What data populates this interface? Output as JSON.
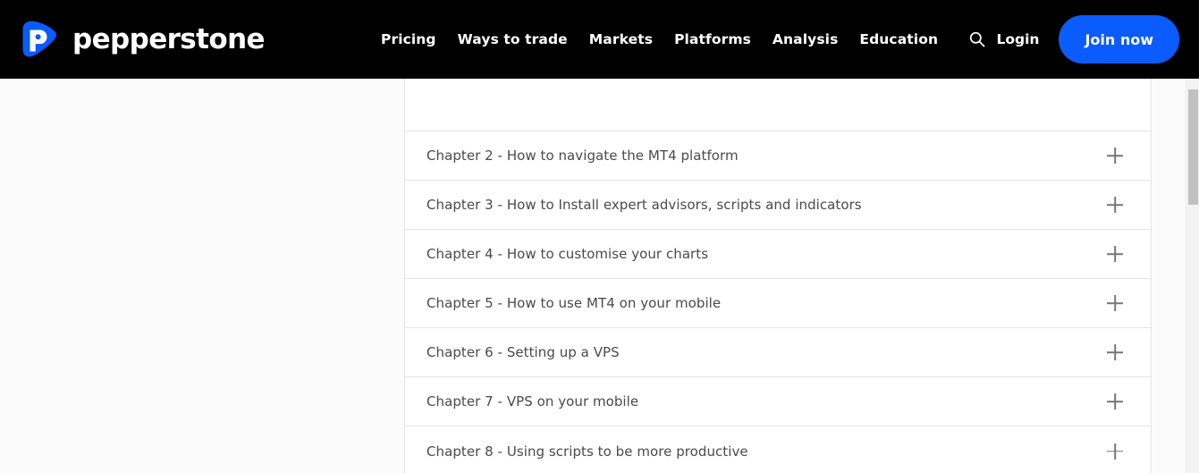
{
  "header": {
    "brand": {
      "name": "pepperstone",
      "logo_icon": "pepperstone-leaf-p-logo",
      "logo_color": "#0a5cff"
    },
    "nav_items": [
      {
        "label": "Pricing"
      },
      {
        "label": "Ways to trade"
      },
      {
        "label": "Markets"
      },
      {
        "label": "Platforms"
      },
      {
        "label": "Analysis"
      },
      {
        "label": "Education"
      }
    ],
    "search_icon": "search-icon",
    "login_label": "Login",
    "join_label": "Join now",
    "background_color": "#000000",
    "accent_color": "#0a5cff"
  },
  "main": {
    "accordion": {
      "expand_icon": "plus-icon",
      "items": [
        {
          "label": "",
          "partial": true
        },
        {
          "label": "Chapter 2 - How to navigate the MT4 platform"
        },
        {
          "label": "Chapter 3 - How to Install expert advisors, scripts and indicators"
        },
        {
          "label": "Chapter 4 - How to customise your charts"
        },
        {
          "label": "Chapter 5 - How to use MT4 on your mobile"
        },
        {
          "label": "Chapter 6 - Setting up a VPS"
        },
        {
          "label": "Chapter 7 - VPS on your mobile"
        },
        {
          "label": "Chapter 8 - Using scripts to be more productive"
        }
      ]
    }
  },
  "scrollbar": {
    "thumb_color": "#c1c1c1",
    "track_color": "#f3f3f3"
  }
}
